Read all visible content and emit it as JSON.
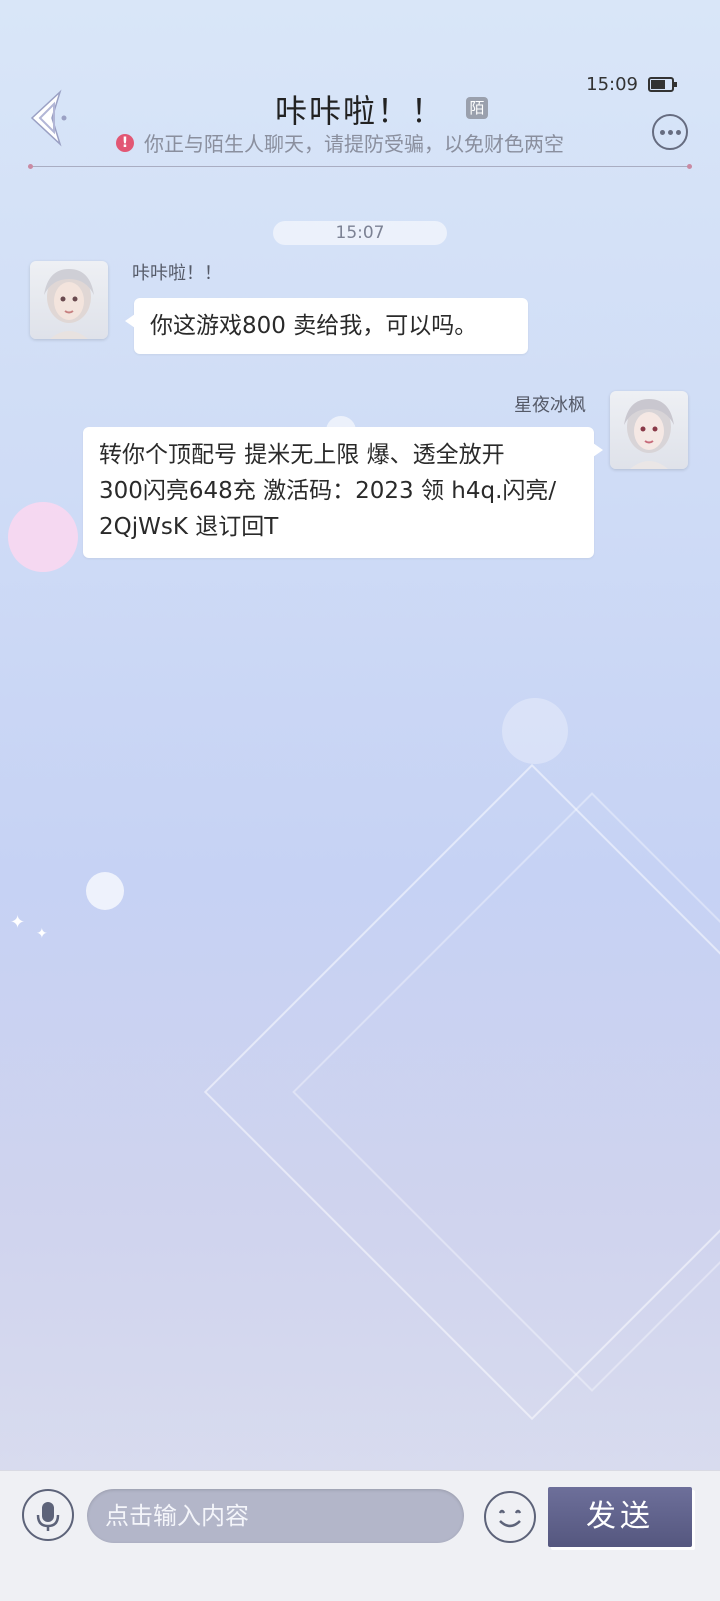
{
  "status": {
    "time": "15:09"
  },
  "header": {
    "title": "咔咔啦！！",
    "stranger_badge": "陌",
    "warning": "你正与陌生人聊天，请提防受骗，以免财色两空"
  },
  "timestamp": "15:07",
  "messages": [
    {
      "side": "left",
      "sender": "咔咔啦！！",
      "text": "你这游戏800 卖给我，可以吗。"
    },
    {
      "side": "right",
      "sender": "星夜冰枫",
      "text": "转你个顶配号 提米无上限 爆、透全放开\n300闪亮648充 激活码：2023 领 h4q.闪亮/\n2QjWsK  退订回T"
    }
  ],
  "input": {
    "placeholder": "点击输入内容",
    "send_label": "发送"
  },
  "icons": {
    "back": "back-arrow-icon",
    "more": "more-icon",
    "mic": "microphone-icon",
    "emoji": "emoji-icon"
  }
}
